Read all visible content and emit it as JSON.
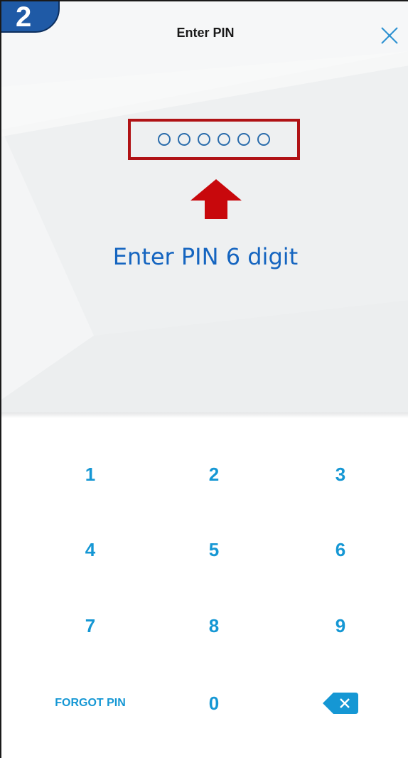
{
  "step_badge": "2",
  "header": {
    "title": "Enter PIN",
    "close_icon": "close-icon"
  },
  "pin": {
    "length": 6,
    "filled": 0
  },
  "annotation": {
    "instruction": "Enter PIN 6 digit",
    "highlight_color": "#b01215",
    "arrow_icon": "up-arrow-icon"
  },
  "keypad": {
    "keys": [
      "1",
      "2",
      "3",
      "4",
      "5",
      "6",
      "7",
      "8",
      "9"
    ],
    "forgot_label": "FORGOT PIN",
    "zero": "0",
    "backspace_icon": "backspace-icon"
  },
  "colors": {
    "accent": "#1597d4",
    "brand_blue": "#1565c0"
  }
}
